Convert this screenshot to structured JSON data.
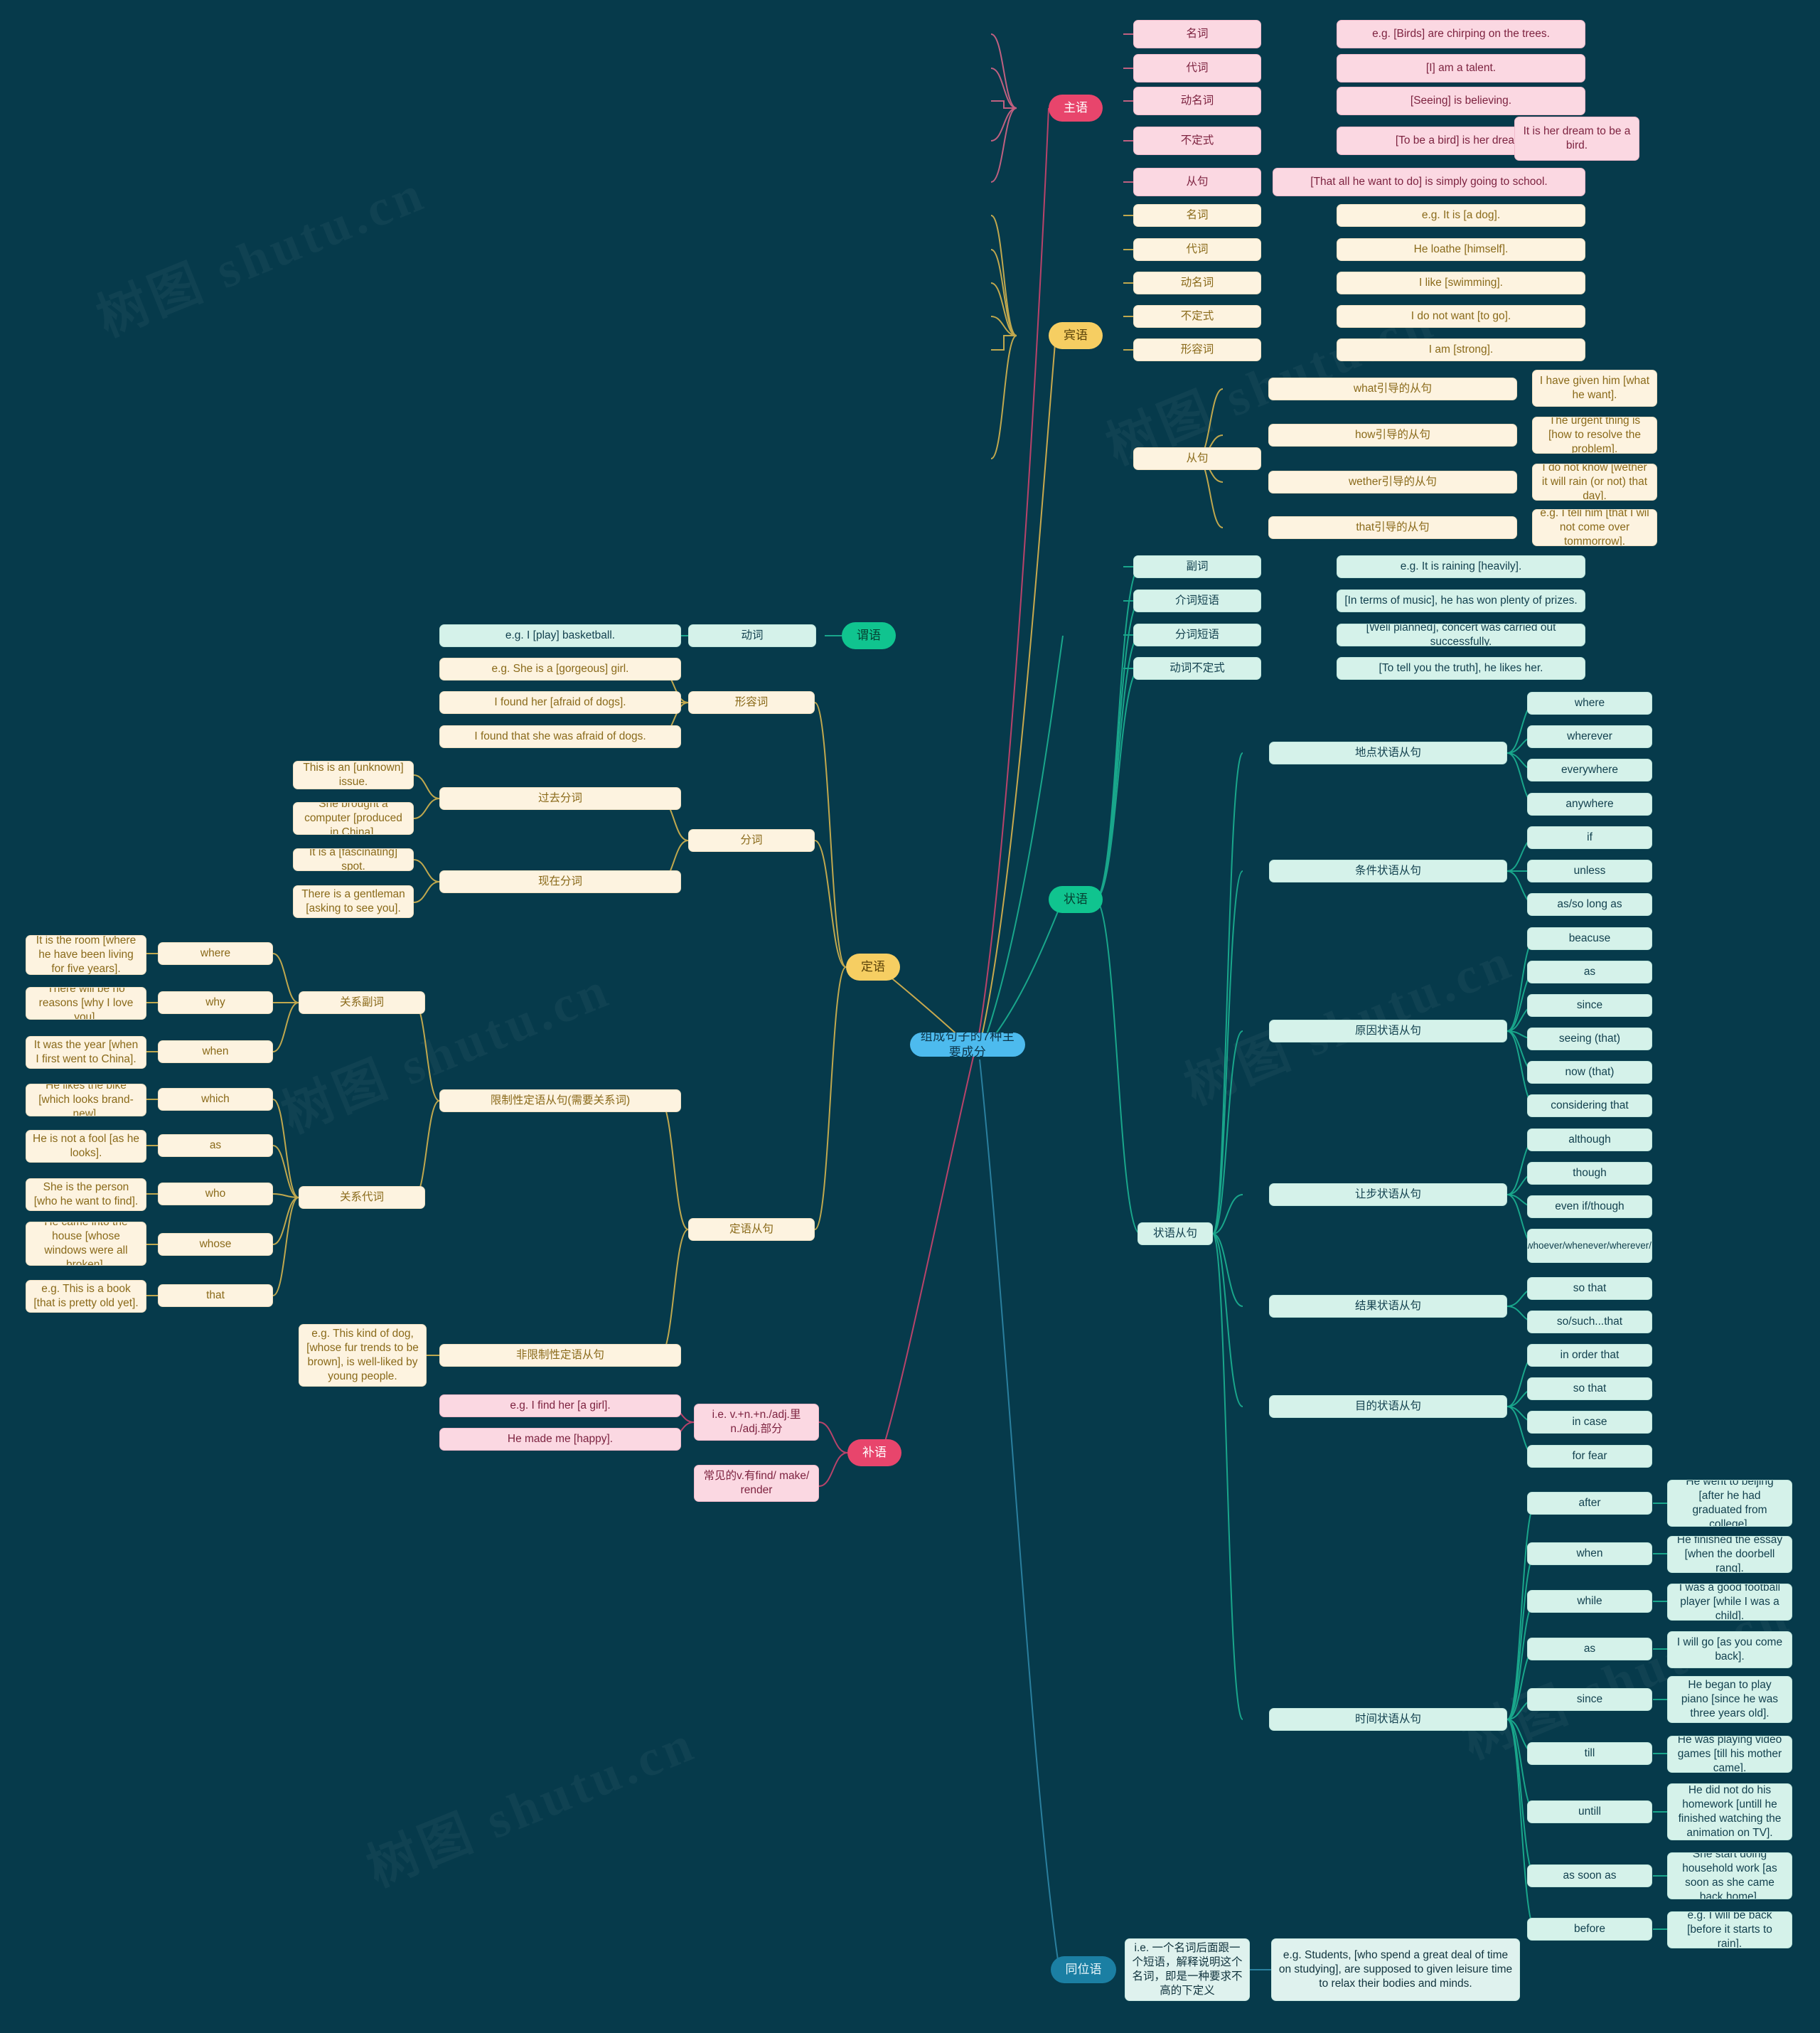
{
  "root": {
    "label": "组成句子的7种主要成分"
  },
  "branches": {
    "subject": {
      "label": "主语",
      "color": "#e8456c"
    },
    "object": {
      "label": "宾语",
      "color": "#f6ce62"
    },
    "predicate": {
      "label": "谓语",
      "color": "#10c48f"
    },
    "adverbial": {
      "label": "状语",
      "color": "#10c48f"
    },
    "attributive": {
      "label": "定语",
      "color": "#f6ce62"
    },
    "complement": {
      "label": "补语",
      "color": "#e8456c"
    },
    "appositive": {
      "label": "同位语",
      "color": "#1b7fa3"
    }
  },
  "subject_items": [
    {
      "type": "名词",
      "example": "e.g. [Birds] are chirping on the trees."
    },
    {
      "type": "代词",
      "example": "[I] am a talent."
    },
    {
      "type": "动名词",
      "example": "[Seeing] is believing."
    },
    {
      "type": "不定式",
      "example": "[To be a bird] is her dream.",
      "extra": "It is her dream to be a bird."
    },
    {
      "type": "从句",
      "example": "[That all he want to do] is simply going to school."
    }
  ],
  "object_items": [
    {
      "type": "名词",
      "example": "e.g. It is [a dog]."
    },
    {
      "type": "代词",
      "example": "He loathe [himself]."
    },
    {
      "type": "动名词",
      "example": "I like [swimming]."
    },
    {
      "type": "不定式",
      "example": "I do not want [to go]."
    },
    {
      "type": "形容词",
      "example": "I am [strong]."
    }
  ],
  "object_clause": {
    "label": "从句",
    "items": [
      {
        "type": "what引导的从句",
        "example": "I have given him [what he want]."
      },
      {
        "type": "how引导的从句",
        "example": "The urgent thing is [how to resolve the problem]."
      },
      {
        "type": "wether引导的从句",
        "example": "I do not know [wether it will rain (or not) that day]."
      },
      {
        "type": "that引导的从句",
        "example": "e.g. I tell him [that I wil not come over tommorrow]."
      }
    ]
  },
  "adverbial_items": [
    {
      "type": "副词",
      "example": "e.g. It is raining [heavily]."
    },
    {
      "type": "介词短语",
      "example": "[In terms of music], he has won plenty of prizes."
    },
    {
      "type": "分词短语",
      "example": "[Well planned], concert was carried out successfully."
    },
    {
      "type": "动词不定式",
      "example": "[To tell you the truth], he likes her."
    }
  ],
  "adverbial_clause": {
    "label": "状语从句",
    "groups": [
      {
        "label": "地点状语从句",
        "words": [
          "where",
          "wherever",
          "everywhere",
          "anywhere"
        ]
      },
      {
        "label": "条件状语从句",
        "words": [
          "if",
          "unless",
          "as/so long as"
        ]
      },
      {
        "label": "原因状语从句",
        "words": [
          "beacuse",
          "as",
          "since",
          "seeing (that)",
          "now (that)",
          "considering that"
        ]
      },
      {
        "label": "让步状语从句",
        "words": [
          "although",
          "though",
          "even if/though",
          "whatever/whoever/whenever/wherever/whichever"
        ]
      },
      {
        "label": "结果状语从句",
        "words": [
          "so that",
          "so/such...that"
        ]
      },
      {
        "label": "目的状语从句",
        "words": [
          "in order that",
          "so that",
          "in case",
          "for fear"
        ]
      }
    ],
    "time": {
      "label": "时间状语从句",
      "items": [
        {
          "word": "after",
          "example": "He went to beijing [after he had graduated from college]."
        },
        {
          "word": "when",
          "example": "He finished the essay [when the doorbell rang]."
        },
        {
          "word": "while",
          "example": "I was a good football player [while I was a child]."
        },
        {
          "word": "as",
          "example": "I will go [as you come back]."
        },
        {
          "word": "since",
          "example": "He began to play piano [since he was three years old]."
        },
        {
          "word": "till",
          "example": "He was playing video games [till his mother came]."
        },
        {
          "word": "untill",
          "example": "He did not do his homework [untill he finished watching the animation on TV]."
        },
        {
          "word": "as soon as",
          "example": "She start doing household work [as soon as she came back home]."
        },
        {
          "word": "before",
          "example": "e.g. I will be back [before it starts to rain]."
        }
      ]
    }
  },
  "predicate": {
    "verb_label": "动词",
    "verb_example": "e.g. I [play] basketball."
  },
  "attributive": {
    "adjective": {
      "label": "形容词",
      "examples": [
        "e.g. She is a [gorgeous] girl.",
        "I found her [afraid of dogs].",
        "I found that she was afraid of dogs."
      ]
    },
    "participle": {
      "label": "分词",
      "past": {
        "label": "过去分词",
        "examples": [
          "This is an [unknown] issue.",
          "She brought a computer [produced in China]."
        ]
      },
      "present": {
        "label": "现在分词",
        "examples": [
          "It is a [fascinating] spot.",
          "There is a gentleman [asking to see you]."
        ]
      }
    },
    "clause": {
      "label": "定语从句",
      "restrictive": {
        "label": "限制性定语从句(需要关系词)",
        "relative_adverb": {
          "label": "关系副词",
          "items": [
            {
              "word": "where",
              "example": "It is the room [where he have been living for five years]."
            },
            {
              "word": "why",
              "example": "There will be no reasons [why I love you]."
            },
            {
              "word": "when",
              "example": "It was the year [when I first went to China]."
            }
          ]
        },
        "relative_pronoun": {
          "label": "关系代词",
          "items": [
            {
              "word": "which",
              "example": "He likes the bike [which looks brand-new]."
            },
            {
              "word": "as",
              "example": "He is not a fool [as he looks]."
            },
            {
              "word": "who",
              "example": "She is the person [who he want to find]."
            },
            {
              "word": "whose",
              "example": "He came into the house [whose windows were all broken]."
            },
            {
              "word": "that",
              "example": "e.g. This is a book [that is pretty old yet]."
            }
          ]
        }
      },
      "nonrestrictive": {
        "label": "非限制性定语从句",
        "example": "e.g. This kind of dog, [whose fur trends to be brown], is well-liked by young people."
      }
    }
  },
  "complement": {
    "note1": "i.e. v.+n.+n./adj.里n./adj.部分",
    "note2": "常见的v.有find/ make/ render",
    "examples": [
      "e.g. I find her [a girl].",
      "He made me [happy]."
    ]
  },
  "appositive": {
    "definition": "i.e. 一个名词后面跟一个短语，解释说明这个名词，即是一种要求不高的下定义",
    "example": "e.g. Students, [who spend a great deal of time on studying], are supposed to given leisure time to relax their bodies and minds."
  },
  "watermarks": [
    "树图 shutu.cn",
    "树图 shutu.cn",
    "树图 shutu.cn",
    "树图 shutu.cn",
    "树图 shutu.cn",
    "树图 shutu.cn"
  ]
}
